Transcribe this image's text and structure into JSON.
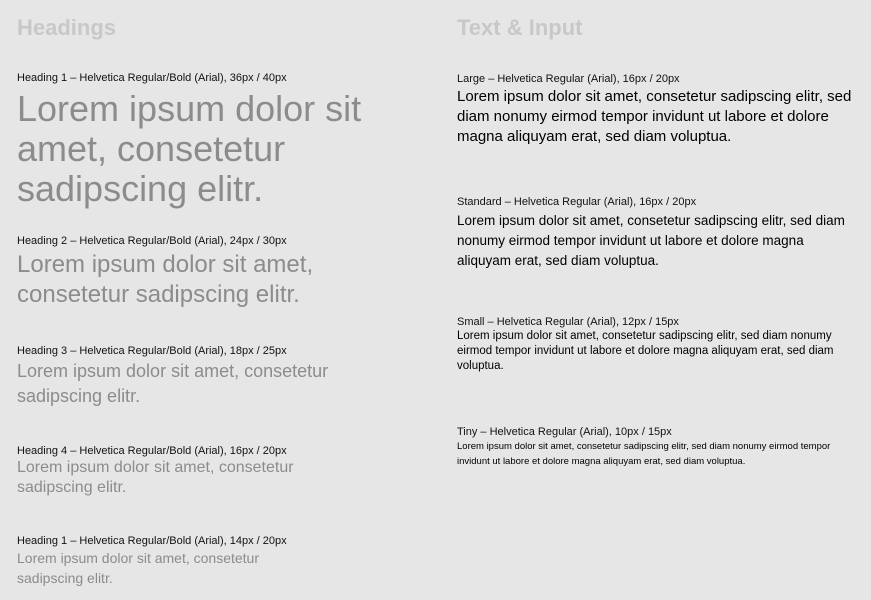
{
  "headings": {
    "title": "Headings",
    "items": [
      {
        "spec": "Heading 1 – Helvetica Regular/Bold (Arial), 36px / 40px",
        "sample": "Lorem ipsum dolor sit amet, consetetur sadipscing elitr."
      },
      {
        "spec": "Heading 2 – Helvetica Regular/Bold (Arial), 24px / 30px",
        "sample": "Lorem ipsum dolor sit amet, consetetur sadipscing elitr."
      },
      {
        "spec": "Heading 3 – Helvetica Regular/Bold (Arial), 18px / 25px",
        "sample": "Lorem ipsum dolor sit amet, consetetur sadipscing elitr."
      },
      {
        "spec": "Heading 4 – Helvetica Regular/Bold (Arial), 16px / 20px",
        "sample": "Lorem ipsum dolor sit amet, consetetur sadipscing elitr."
      },
      {
        "spec": "Heading 1 – Helvetica Regular/Bold (Arial), 14px / 20px",
        "sample": "Lorem ipsum dolor sit amet, consetetur sadipscing elitr."
      }
    ]
  },
  "text_input": {
    "title": "Text & Input",
    "items": [
      {
        "spec": "Large – Helvetica Regular (Arial), 16px / 20px",
        "sample": "Lorem ipsum dolor sit amet, consetetur sadipscing elitr, sed diam nonumy eirmod tempor invidunt ut labore et dolore magna aliquyam erat, sed diam voluptua."
      },
      {
        "spec": "Standard – Helvetica Regular (Arial), 16px / 20px",
        "sample": "Lorem ipsum dolor sit amet, consetetur sadipscing elitr, sed diam nonumy eirmod tempor invidunt ut labore et dolore magna aliquyam erat, sed diam voluptua."
      },
      {
        "spec": "Small – Helvetica Regular (Arial), 12px / 15px",
        "sample": "Lorem ipsum dolor sit amet, consetetur sadipscing elitr, sed diam nonumy eirmod tempor invidunt ut labore et dolore magna aliquyam erat, sed diam voluptua."
      },
      {
        "spec": "Tiny – Helvetica Regular (Arial), 10px / 15px",
        "sample": "Lorem ipsum dolor sit amet, consetetur sadipscing elitr, sed diam nonumy eirmod tempor invidunt ut labore et dolore magna aliquyam erat, sed diam voluptua."
      }
    ]
  },
  "colors": {
    "background": "#e6e6e6",
    "section_title": "#c8c8c8",
    "heading_sample": "#8c8c8c",
    "body_text": "#000000"
  }
}
